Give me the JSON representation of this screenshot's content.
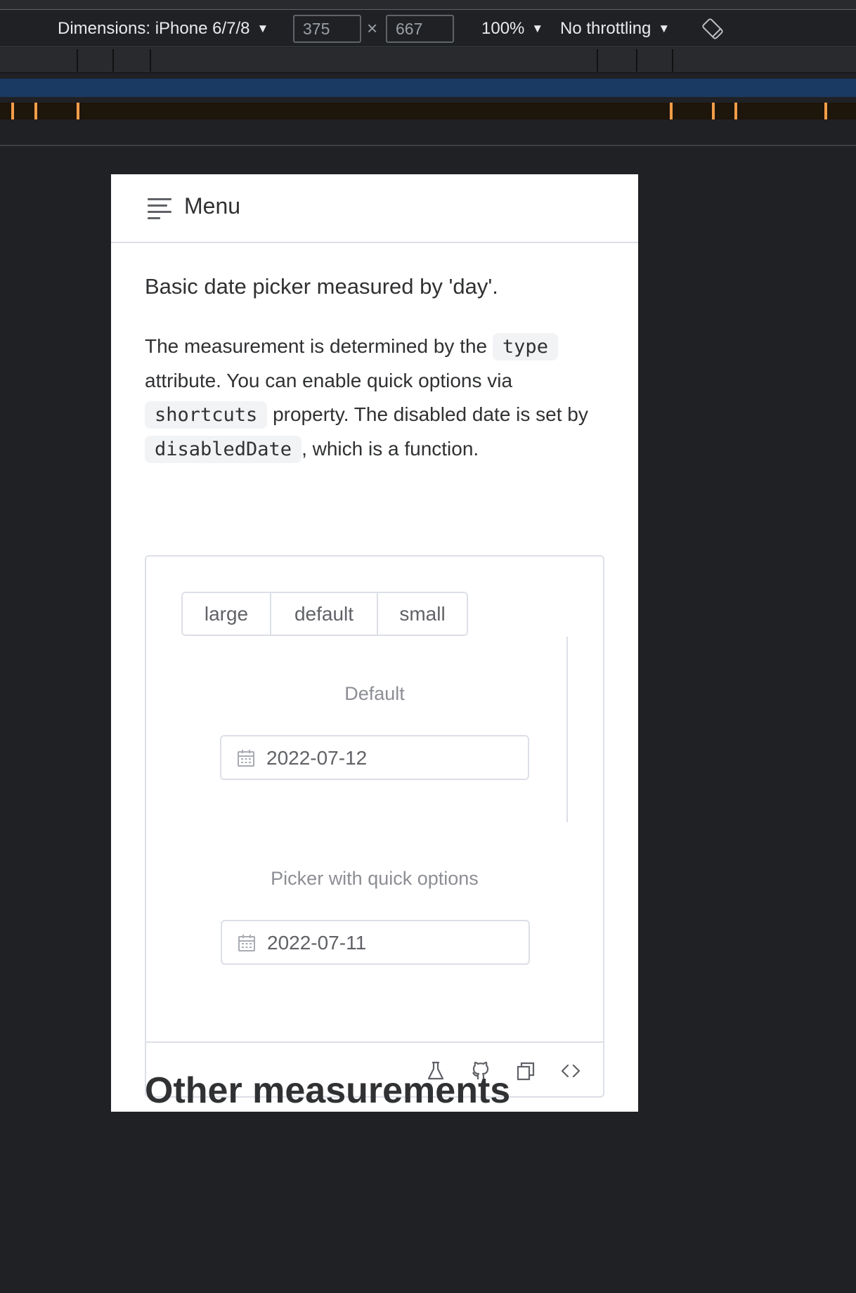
{
  "devtools": {
    "dimensions_label": "Dimensions: iPhone 6/7/8",
    "width_value": "375",
    "height_value": "667",
    "times_symbol": "×",
    "zoom_label": "100%",
    "throttling_label": "No throttling",
    "dropdown_arrow": "▼",
    "rotate_icon": "rotate-icon"
  },
  "page": {
    "menu_label": "Menu",
    "intro": "Basic date picker measured by 'day'.",
    "desc": {
      "part1": "The measurement is determined by the ",
      "code1": "type",
      "part2": " attribute. You can enable quick options via ",
      "code2": "shortcuts",
      "part3": " property. The disabled date is set by ",
      "code3": "disabledDate",
      "part4": ", which is a function."
    },
    "size_options": [
      "large",
      "default",
      "small"
    ],
    "blocks": [
      {
        "title": "Default",
        "value": "2022-07-12"
      },
      {
        "title": "Picker with quick options",
        "value": "2022-07-11"
      }
    ],
    "footer_icons": [
      "playground-icon",
      "github-icon",
      "copy-icon",
      "code-icon"
    ],
    "next_heading": "Other measurements"
  },
  "colors": {
    "devtools_bg": "#202124",
    "media_blue": "#1a3a63",
    "media_orange": "#f29d49",
    "border": "#dcdfe6",
    "text_primary": "#303133",
    "text_secondary": "#8c8e94"
  }
}
